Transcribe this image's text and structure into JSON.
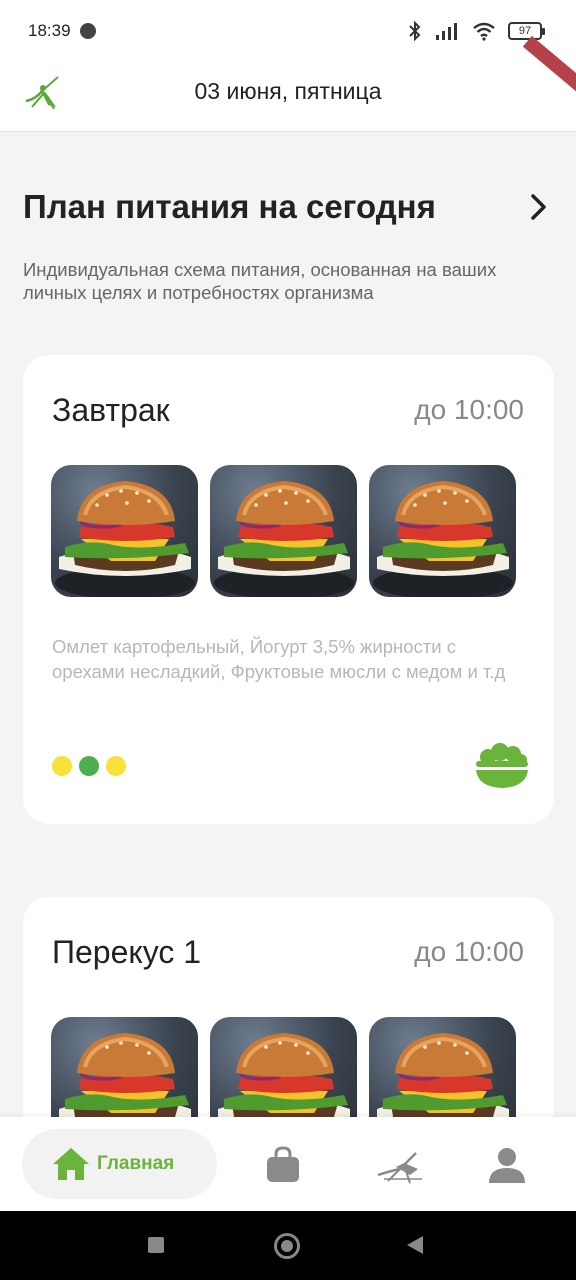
{
  "status_bar": {
    "time": "18:39",
    "battery": "97"
  },
  "header": {
    "date": "03 июня, пятница",
    "logo_icon": "mosquito-logo-icon"
  },
  "plan": {
    "title": "План питания на сегодня",
    "subtitle": "Индивидуальная схема питания, основанная на ваших личных целях и потребностях организма",
    "chevron_icon": "chevron-right-icon"
  },
  "meals": [
    {
      "name": "Завтрак",
      "time": "до 10:00",
      "photos": [
        "burger-photo",
        "burger-photo",
        "burger-photo"
      ],
      "description": "Омлет картофельный, Йогурт 3,5% жирности с орехами несладкий, Фруктовые мюсли с медом и т.д",
      "dots": [
        "#f7e13b",
        "#4caf50",
        "#f7e13b"
      ],
      "category_icon": "salad-bowl-icon"
    },
    {
      "name": "Перекус 1",
      "time": "до 10:00",
      "photos": [
        "burger-photo",
        "burger-photo",
        "burger-photo"
      ]
    }
  ],
  "bottom_nav": {
    "home_label": "Главная",
    "items": [
      "home-icon",
      "shopping-bag-icon",
      "mosquito-icon",
      "profile-icon"
    ]
  },
  "colors": {
    "accent": "#6ab43b",
    "background": "#f4f4f4",
    "card": "#ffffff"
  }
}
